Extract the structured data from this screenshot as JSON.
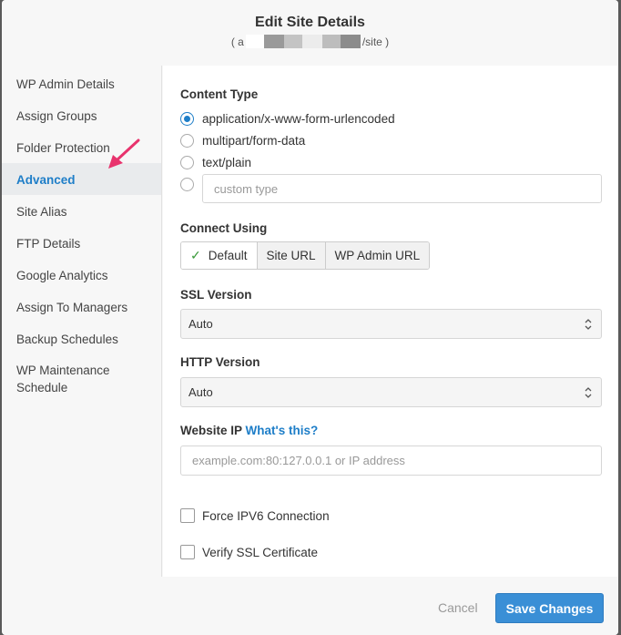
{
  "header": {
    "title": "Edit Site Details",
    "subtitle_prefix": "( a",
    "subtitle_suffix": "/site )"
  },
  "sidebar": {
    "items": [
      {
        "label": "WP Admin Details"
      },
      {
        "label": "Assign Groups"
      },
      {
        "label": "Folder Protection"
      },
      {
        "label": "Advanced"
      },
      {
        "label": "Site Alias"
      },
      {
        "label": "FTP Details"
      },
      {
        "label": "Google Analytics"
      },
      {
        "label": "Assign To Managers"
      },
      {
        "label": "Backup Schedules"
      },
      {
        "label": "WP Maintenance Schedule"
      }
    ],
    "active": "Advanced"
  },
  "content_type": {
    "label": "Content Type",
    "options": [
      "application/x-www-form-urlencoded",
      "multipart/form-data",
      "text/plain"
    ],
    "selected": "application/x-www-form-urlencoded",
    "custom_placeholder": "custom type"
  },
  "connect_using": {
    "label": "Connect Using",
    "options": [
      "Default",
      "Site URL",
      "WP Admin URL"
    ],
    "selected": "Default"
  },
  "ssl_version": {
    "label": "SSL Version",
    "value": "Auto"
  },
  "http_version": {
    "label": "HTTP Version",
    "value": "Auto"
  },
  "website_ip": {
    "label": "Website IP",
    "help_link": "What's this?",
    "placeholder": "example.com:80:127.0.0.1 or IP address"
  },
  "checkboxes": {
    "force_ipv6": "Force IPV6 Connection",
    "verify_ssl": "Verify SSL Certificate"
  },
  "footer": {
    "cancel_label": "Cancel",
    "save_label": "Save Changes"
  },
  "colors": {
    "accent": "#1e7ec8",
    "save_button": "#3a8fd6",
    "annotation_arrow": "#e8336d"
  }
}
